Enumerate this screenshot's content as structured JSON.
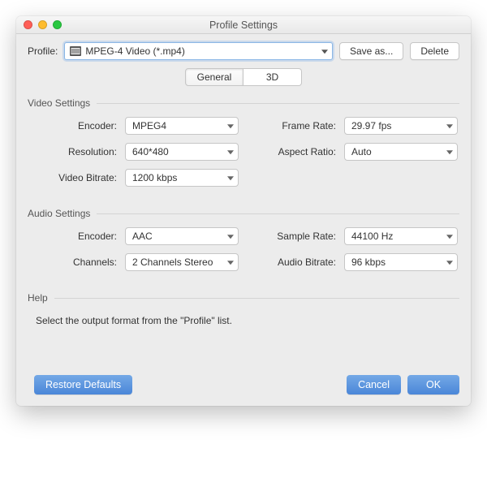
{
  "window": {
    "title": "Profile Settings"
  },
  "profile": {
    "label": "Profile:",
    "value": "MPEG-4 Video (*.mp4)",
    "save_as": "Save as...",
    "delete": "Delete"
  },
  "tabs": {
    "general": "General",
    "three_d": "3D"
  },
  "video": {
    "title": "Video Settings",
    "encoder_label": "Encoder:",
    "encoder_value": "MPEG4",
    "framerate_label": "Frame Rate:",
    "framerate_value": "29.97 fps",
    "resolution_label": "Resolution:",
    "resolution_value": "640*480",
    "aspect_label": "Aspect Ratio:",
    "aspect_value": "Auto",
    "vbitrate_label": "Video Bitrate:",
    "vbitrate_value": "1200 kbps"
  },
  "audio": {
    "title": "Audio Settings",
    "encoder_label": "Encoder:",
    "encoder_value": "AAC",
    "samplerate_label": "Sample Rate:",
    "samplerate_value": "44100 Hz",
    "channels_label": "Channels:",
    "channels_value": "2 Channels Stereo",
    "abitrate_label": "Audio Bitrate:",
    "abitrate_value": "96 kbps"
  },
  "help": {
    "title": "Help",
    "text": "Select the output format from the \"Profile\" list."
  },
  "footer": {
    "restore": "Restore Defaults",
    "cancel": "Cancel",
    "ok": "OK"
  }
}
